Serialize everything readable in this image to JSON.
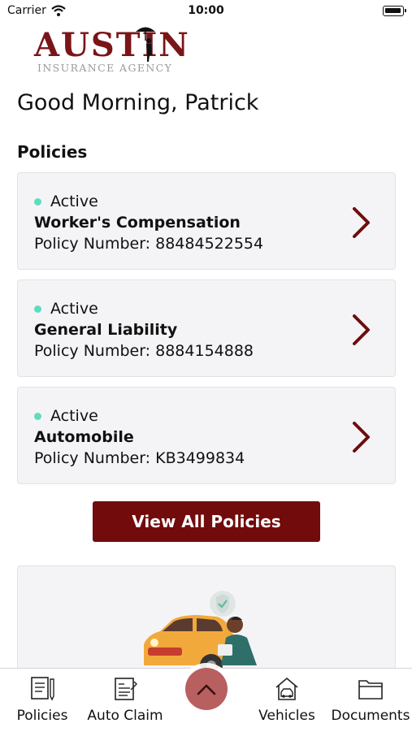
{
  "status_bar": {
    "carrier": "Carrier",
    "time": "10:00"
  },
  "logo": {
    "word": "AUSTIN",
    "sub": "INSURANCE AGENCY"
  },
  "greeting": "Good Morning, Patrick",
  "section_title": "Policies",
  "policies": [
    {
      "status": "Active",
      "title": "Worker's Compensation",
      "number": "Policy Number: 88484522554"
    },
    {
      "status": "Active",
      "title": "General Liability",
      "number": "Policy Number: 8884154888"
    },
    {
      "status": "Active",
      "title": "Automobile",
      "number": "Policy Number: KB3499834"
    }
  ],
  "view_all_label": "View All Policies",
  "colors": {
    "brand": "#720b0b",
    "active_dot": "#5fdcc0",
    "card_bg": "#f4f4f6",
    "fab": "#b85f60"
  },
  "tabs": [
    {
      "label": "Policies",
      "icon": "policies-icon"
    },
    {
      "label": "Auto Claim",
      "icon": "auto-claim-icon"
    },
    {
      "label": "Vehicles",
      "icon": "vehicles-icon"
    },
    {
      "label": "Documents",
      "icon": "documents-icon"
    }
  ]
}
